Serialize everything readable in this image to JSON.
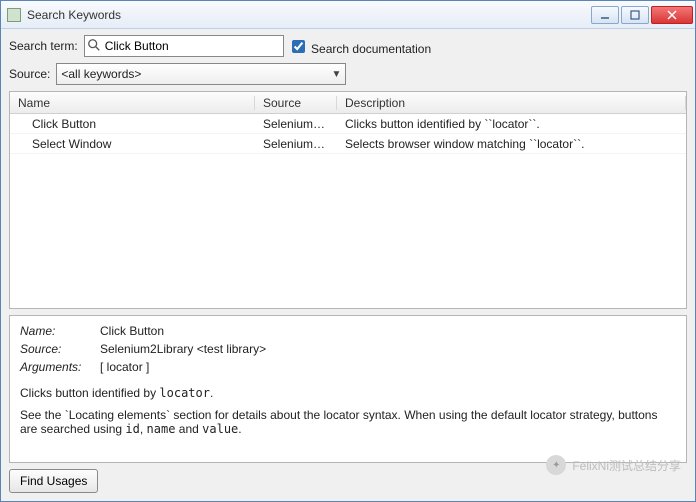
{
  "window": {
    "title": "Search Keywords"
  },
  "form": {
    "searchLabel": "Search term:",
    "searchValue": "Click Button",
    "docCheckbox": {
      "checked": true,
      "label": "Search documentation"
    },
    "sourceLabel": "Source:",
    "sourceSelected": "<all keywords>"
  },
  "table": {
    "headers": {
      "name": "Name",
      "source": "Source",
      "description": "Description"
    },
    "rows": [
      {
        "name": "Click Button",
        "source": "Selenium2...",
        "description": "Clicks button identified by ``locator``."
      },
      {
        "name": "Select Window",
        "source": "Selenium2...",
        "description": "Selects browser window matching ``locator``."
      }
    ]
  },
  "details": {
    "labels": {
      "name": "Name:",
      "source": "Source:",
      "arguments": "Arguments:"
    },
    "name": "Click Button",
    "source": "Selenium2Library <test library>",
    "arguments": "[ locator ]",
    "doc1a": "Clicks button identified by ",
    "doc1b": "locator",
    "doc1c": ".",
    "doc2a": "See the `Locating elements` section for details about the locator syntax. When using the default locator strategy, buttons are searched using ",
    "doc2b": "id",
    "doc2c": ", ",
    "doc2d": "name",
    "doc2e": " and ",
    "doc2f": "value",
    "doc2g": "."
  },
  "footer": {
    "findUsages": "Find Usages"
  },
  "watermark": "FelixNi测试总结分享"
}
